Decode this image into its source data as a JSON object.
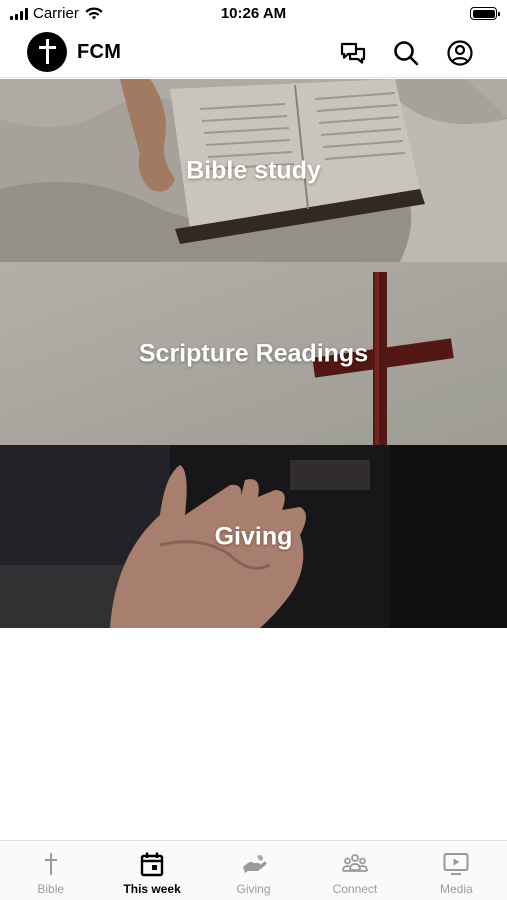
{
  "status_bar": {
    "carrier": "Carrier",
    "time": "10:26 AM"
  },
  "header": {
    "app_name": "FCM",
    "icons": [
      "chat-icon",
      "search-icon",
      "account-icon"
    ]
  },
  "cards": [
    {
      "label": "Bible study"
    },
    {
      "label": "Scripture Readings"
    },
    {
      "label": "Giving"
    }
  ],
  "tab_bar": {
    "active": "This week",
    "active_color": "#000000",
    "inactive_color": "#9a9a9a",
    "tabs": [
      {
        "label": "Bible",
        "icon": "cross-icon"
      },
      {
        "label": "This week",
        "icon": "calendar-icon"
      },
      {
        "label": "Giving",
        "icon": "giving-hand-icon"
      },
      {
        "label": "Connect",
        "icon": "group-icon"
      },
      {
        "label": "Media",
        "icon": "media-play-icon"
      }
    ]
  }
}
